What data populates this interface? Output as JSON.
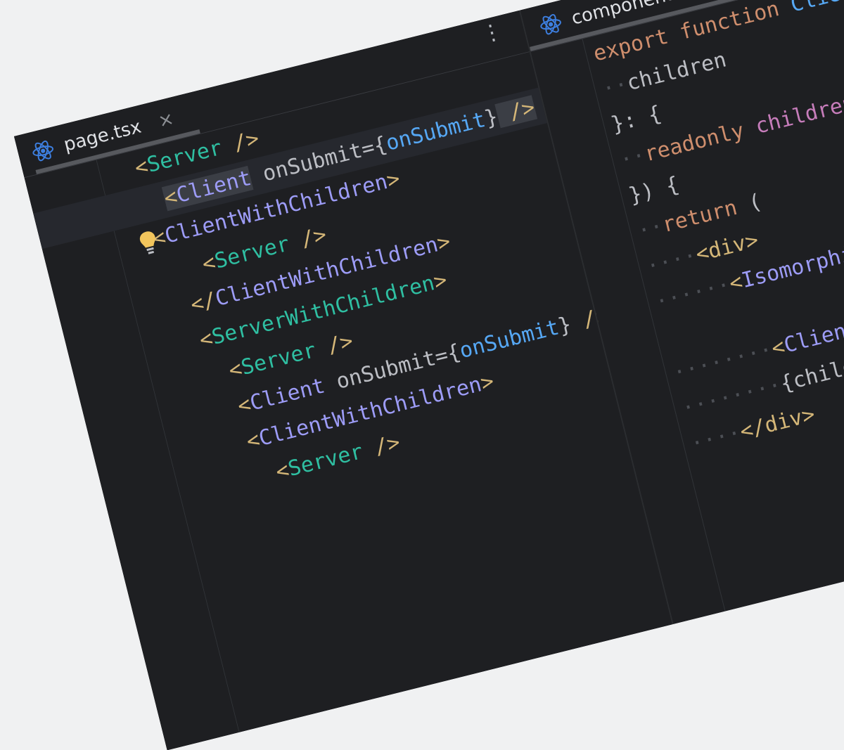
{
  "left_tab": {
    "label": "page.tsx",
    "close": "×",
    "icon": "react-icon"
  },
  "right_tab": {
    "label": "components.tsx",
    "icon": "react-icon"
  },
  "kebab_label": "⋮",
  "check_label": "✓",
  "left_code": {
    "l1": {
      "a": "<",
      "b": "Server",
      "c": " />"
    },
    "l2": {
      "a": "<",
      "b": "Client",
      "c": " onSubmit",
      "d": "={",
      "e": "onSubmit",
      "f": "}",
      "g": " />"
    },
    "l3": {
      "a": "<",
      "b": "ClientWithChildren",
      "c": ">"
    },
    "l4": {
      "a": "<",
      "b": "Server",
      "c": " />"
    },
    "l5": {
      "a": "</",
      "b": "ClientWithChildren",
      "c": ">"
    },
    "l6": {
      "a": "<",
      "b": "ServerWithChildren",
      "c": ">"
    },
    "l7": {
      "a": "<",
      "b": "Server",
      "c": " />"
    },
    "l8": {
      "a": "<",
      "b": "Client",
      "c": " onSubmit",
      "d": "={",
      "e": "onSubmit",
      "f": "}",
      "g": " />"
    },
    "l9": {
      "a": "<",
      "b": "ClientWithChildren",
      "c": ">"
    },
    "l10": {
      "a": "<",
      "b": "Server",
      "c": " />"
    }
  },
  "right_code": {
    "r1": {
      "a": "export",
      "b": " function ",
      "c": "Client"
    },
    "r2": {
      "dots": "··",
      "a": "children"
    },
    "r3": {
      "a": "}: {"
    },
    "r4": {
      "dots": "··",
      "a": "readonly",
      "b": " children"
    },
    "r5": {
      "a": "}) {"
    },
    "r6": {
      "dots": "··",
      "a": "return",
      "b": " ("
    },
    "r7": {
      "dots": "····",
      "a": "<",
      "b": "div",
      "c": ">"
    },
    "r8": {
      "dots": "······",
      "a": "<",
      "b": "Isomorphic"
    },
    "r9": {
      "dots": "········",
      "a": "<",
      "b": "Client",
      "c": " /"
    },
    "r10": {
      "dots": "········",
      "a": "{children}"
    },
    "r11": {
      "dots": "····",
      "a": "</",
      "b": "div",
      "c": ">"
    }
  },
  "colors": {
    "background": "#1e1f22",
    "tag_bracket": "#d5b778",
    "html_tag": "#2fbfa2",
    "component_tag": "#9d9cf7",
    "attr_value": "#56a8f5",
    "keyword": "#cf8e6d",
    "property": "#c77dbb",
    "react_blue": "#3d7fe0",
    "check_green": "#5fb865"
  }
}
